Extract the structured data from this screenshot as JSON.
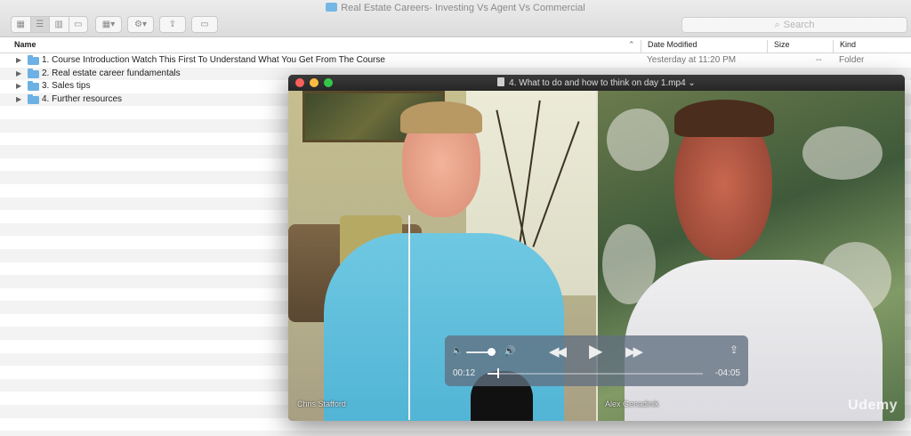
{
  "finder": {
    "window_title": "Real Estate Careers- Investing Vs Agent Vs Commercial",
    "search_placeholder": "Search",
    "columns": {
      "name": "Name",
      "date": "Date Modified",
      "size": "Size",
      "kind": "Kind"
    },
    "items": [
      {
        "name": "1. Course Introduction Watch This First To Understand What You Get From The Course",
        "date": "Yesterday at 11:20 PM",
        "size": "--",
        "kind": "Folder"
      },
      {
        "name": "2. Real estate career fundamentals"
      },
      {
        "name": "3. Sales tips"
      },
      {
        "name": "4. Further resources"
      }
    ]
  },
  "player": {
    "title": "4. What to do and how to think on day 1.mp4",
    "left_speaker": "Chris Stafford",
    "right_speaker": "Alex Genadinik",
    "watermark": "Udemy",
    "elapsed": "00:12",
    "remaining": "-04:05",
    "progress": 0.047,
    "volume": 0.85
  }
}
